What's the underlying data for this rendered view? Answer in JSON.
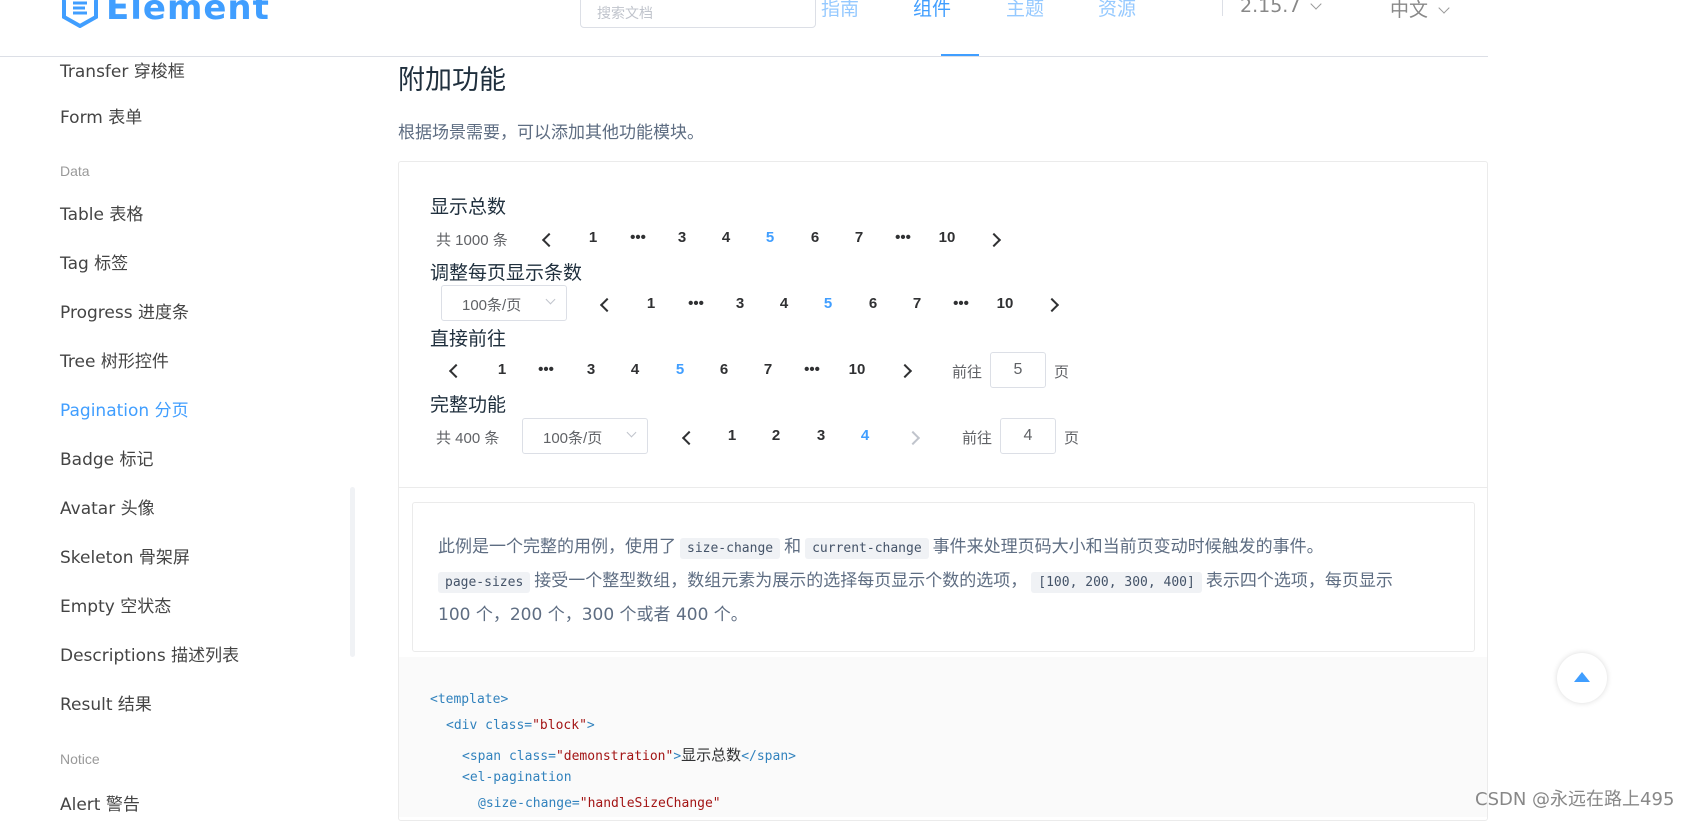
{
  "header": {
    "logo_text": "Element",
    "search_placeholder": "搜索文档",
    "nav": [
      "指南",
      "组件",
      "主题",
      "资源"
    ],
    "version": "2.15.7",
    "language": "中文"
  },
  "sidebar": {
    "items_top": [
      "Transfer 穿梭框",
      "Form 表单"
    ],
    "group_data": "Data",
    "items_data": [
      "Table 表格",
      "Tag 标签",
      "Progress 进度条",
      "Tree 树形控件",
      "Pagination 分页",
      "Badge 标记",
      "Avatar 头像",
      "Skeleton 骨架屏",
      "Empty 空状态",
      "Descriptions 描述列表",
      "Result 结果"
    ],
    "group_notice": "Notice",
    "items_notice": [
      "Alert 警告"
    ],
    "active": "Pagination 分页"
  },
  "section": {
    "title": "附加功能",
    "description": "根据场景需要，可以添加其他功能模块。"
  },
  "demos": {
    "total": {
      "label": "显示总数",
      "total_text": "共 1000 条",
      "pages": [
        "1",
        "•••",
        "3",
        "4",
        "5",
        "6",
        "7",
        "•••",
        "10"
      ],
      "current": "5"
    },
    "sizes": {
      "label": "调整每页显示条数",
      "size_value": "100条/页",
      "pages": [
        "1",
        "•••",
        "3",
        "4",
        "5",
        "6",
        "7",
        "•••",
        "10"
      ],
      "current": "5"
    },
    "jumper": {
      "label": "直接前往",
      "pages": [
        "1",
        "•••",
        "3",
        "4",
        "5",
        "6",
        "7",
        "•••",
        "10"
      ],
      "current": "5",
      "goto_prefix": "前往",
      "goto_value": "5",
      "goto_suffix": "页"
    },
    "full": {
      "label": "完整功能",
      "total_text": "共 400 条",
      "size_value": "100条/页",
      "pages": [
        "1",
        "2",
        "3",
        "4"
      ],
      "current": "4",
      "goto_prefix": "前往",
      "goto_value": "4",
      "goto_suffix": "页"
    }
  },
  "description": {
    "p1_a": "此例是一个完整的用例，使用了",
    "code1": "size-change",
    "p1_b": "和",
    "code2": "current-change",
    "p1_c": "事件来处理页码大小和当前页变动时候触发的事件。",
    "code3": "page-sizes",
    "p2_a": "接受一个整型数组，数组元素为展示的选择每页显示个数的选项，",
    "code4": "[100, 200, 300, 400]",
    "p2_b": "表示四个选项，每页显示",
    "p3": "100 个，200 个，300 个或者 400 个。"
  },
  "code": {
    "line1": "<template>",
    "line2_tag": "<div",
    "line2_attr": " class=",
    "line2_str": "\"block\"",
    "line2_end": ">",
    "line3_tag": "<span",
    "line3_attr": " class=",
    "line3_str": "\"demonstration\"",
    "line3_mid": ">",
    "line3_text": "显示总数",
    "line3_end": "</span>",
    "line4": "<el-pagination",
    "line5_attr": "@size-change=",
    "line5_str": "\"handleSizeChange\""
  },
  "watermark": "CSDN @永远在路上495",
  "colors": {
    "primary": "#409eff",
    "text": "#303133",
    "muted": "#5e6d82"
  }
}
